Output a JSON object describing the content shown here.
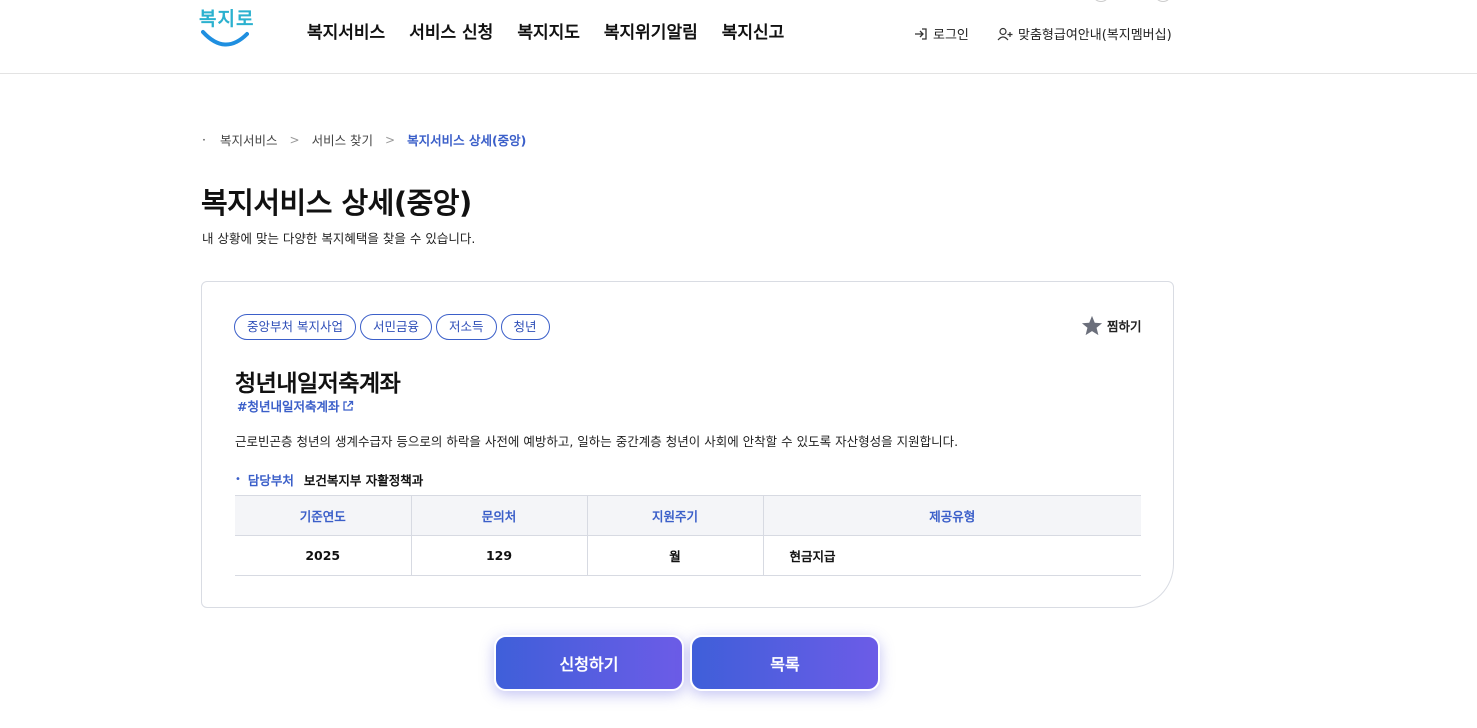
{
  "header": {
    "logo_text": "복지로",
    "nav": [
      "복지서비스",
      "서비스 신청",
      "복지지도",
      "복지위기알림",
      "복지신고"
    ],
    "login_label": "로그인",
    "member_label": "맞춤형급여안내(복지멤버십)"
  },
  "breadcrumb": {
    "items": [
      "복지서비스",
      "서비스 찾기"
    ],
    "current": "복지서비스 상세(중앙)"
  },
  "page": {
    "title": "복지서비스 상세(중앙)",
    "description": "내 상황에 맞는 다양한 복지혜택을 찾을 수 있습니다."
  },
  "service": {
    "tags": [
      "중앙부처 복지사업",
      "서민금융",
      "저소득",
      "청년"
    ],
    "favorite_label": "찜하기",
    "name": "청년내일저축계좌",
    "hashtag": "#청년내일저축계좌",
    "description": "근로빈곤층 청년의 생계수급자 등으로의 하락을 사전에 예방하고, 일하는 중간계층 청년이 사회에 안착할 수 있도록 자산형성을 지원합니다.",
    "dept_label": "담당부처",
    "dept_value": "보건복지부 자활정책과",
    "table": {
      "headers": [
        "기준연도",
        "문의처",
        "지원주기",
        "제공유형"
      ],
      "row": [
        "2025",
        "129",
        "월",
        "현금지급"
      ]
    }
  },
  "buttons": {
    "apply": "신청하기",
    "list": "목록"
  },
  "colors": {
    "accent": "#3b5fc9",
    "logo": "#2bb1cf",
    "button_gradient_start": "#3f5fd9",
    "button_gradient_end": "#6c5ce7"
  }
}
